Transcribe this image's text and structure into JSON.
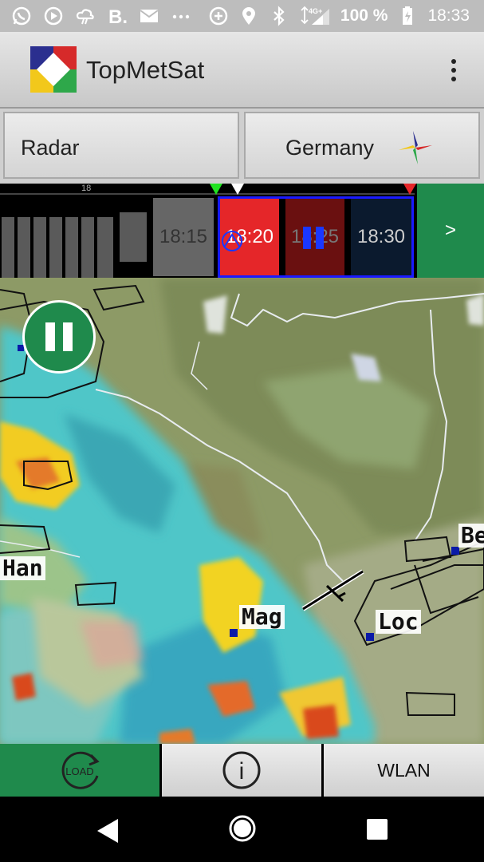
{
  "status_bar": {
    "battery_text": "100 %",
    "time": "18:33",
    "network": "4G+",
    "icons": [
      "whatsapp-icon",
      "play-icon",
      "weather-icon",
      "booking-icon",
      "mail-icon",
      "more-icon",
      "data-saver-icon",
      "location-icon",
      "bluetooth-icon",
      "signal-icon",
      "battery-icon"
    ]
  },
  "app_bar": {
    "title": "TopMetSat",
    "logo_colors": [
      "#2b2f8f",
      "#d62a2a",
      "#2ea84a",
      "#f2c81b"
    ]
  },
  "selectors": {
    "product": "Radar",
    "region": "Germany"
  },
  "timeline": {
    "mark_label": "18",
    "frames": [
      "18:15",
      "18:20",
      "18:25",
      "18:30"
    ],
    "next_label": ">"
  },
  "map": {
    "labels": {
      "han": "Han",
      "mag": "Mag",
      "loc": "Loc",
      "be": "Be"
    }
  },
  "bottom_bar": {
    "load_label": "LOAD",
    "info_label": "i",
    "wlan_label": "WLAN"
  },
  "colors": {
    "accent_green": "#1f8a4c",
    "selection_blue": "#1a1aff",
    "current_frame_red": "#e52629"
  }
}
